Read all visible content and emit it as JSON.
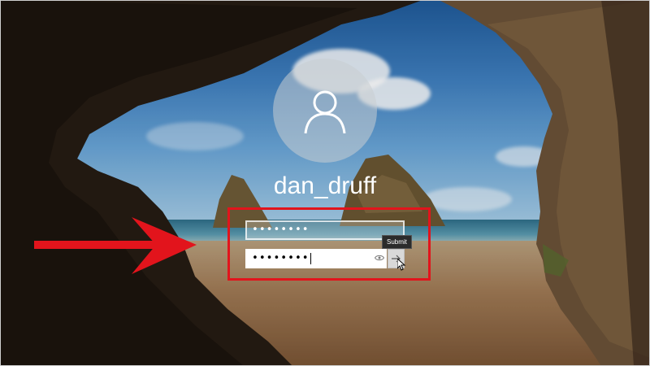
{
  "login": {
    "username": "dan_druff",
    "password_top_value": "••••••••",
    "password_bottom_value": "••••••••",
    "submit_tooltip": "Submit"
  },
  "icons": {
    "avatar": "user-icon",
    "reveal": "eye-icon",
    "submit": "arrow-right-icon",
    "pointer": "mouse-cursor-icon",
    "annotation": "red-arrow-icon"
  },
  "colors": {
    "annotation_red": "#e2141c",
    "text_white": "#ffffff",
    "submit_button": "#d9d9d9",
    "tooltip_bg": "#2b2b2b"
  }
}
